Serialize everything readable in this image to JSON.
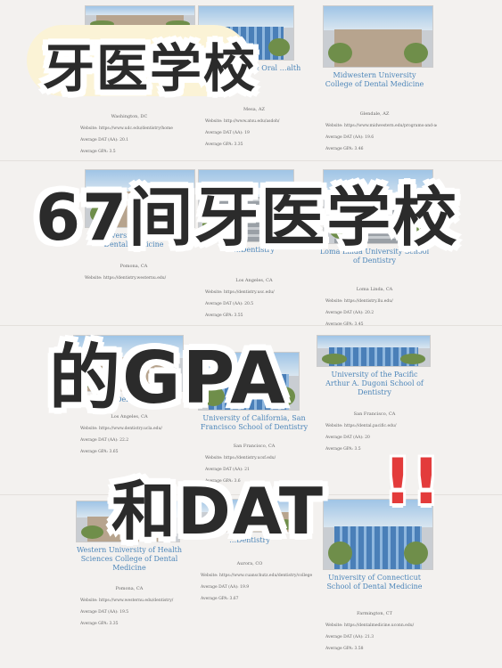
{
  "overlay": {
    "title_top": "牙医学校",
    "line2": "67间牙医学校",
    "line3": "的GPA",
    "line4": "和DAT",
    "exclaim": "!!"
  },
  "cards": [
    {
      "name": "Dentistry",
      "loc": "Washington, DC",
      "site": "Website: https://www.udc.edu/dentistry/home",
      "dat": "Average DAT (AA): 20.1",
      "gpa": "Average GPA: 3.5"
    },
    {
      "name": "…ool of …al & Oral …alth",
      "loc": "Mesa, AZ",
      "site": "Website: http://www.atsu.edu/asdoh/",
      "dat": "Average DAT (AA): 19",
      "gpa": "Average GPA: 3.35"
    },
    {
      "name": "Midwestern University College of Dental Medicine",
      "loc": "Glendale, AZ",
      "site": "Website: https://www.midwestern.edu/programs-and-admission/",
      "dat": "Average DAT (AA): 19.6",
      "gpa": "Average GPA: 3.46"
    },
    {
      "name": "…University, College of Dental Medicine",
      "loc": "Pomona, CA",
      "site": "Website: https://dentistry.westernu.edu/",
      "dat": "",
      "gpa": ""
    },
    {
      "name": "…Dentistry",
      "loc": "Los Angeles, CA",
      "site": "Website: https://dentistry.usc.edu/",
      "dat": "Average DAT (AA): 20.5",
      "gpa": "Average GPA: 3.55"
    },
    {
      "name": "Loma Linda University School of Dentistry",
      "loc": "Loma Linda, CA",
      "site": "Website: https://dentistry.llu.edu/",
      "dat": "Average DAT (AA): 20.2",
      "gpa": "Average GPA: 3.45"
    },
    {
      "name": "…Dentistry",
      "loc": "Los Angeles, CA",
      "site": "Website: https://www.dentistry.ucla.edu/",
      "dat": "Average DAT (AA): 22.2",
      "gpa": "Average GPA: 3.65"
    },
    {
      "name": "University of California, San Francisco School of Dentistry",
      "loc": "San Francisco, CA",
      "site": "Website: https://dentistry.ucsf.edu/",
      "dat": "Average DAT (AA): 21",
      "gpa": "Average GPA: 3.6"
    },
    {
      "name": "University of the Pacific Arthur A. Dugoni School of Dentistry",
      "loc": "San Francisco, CA",
      "site": "Website: https://dental.pacific.edu/",
      "dat": "Average DAT (AA): 20",
      "gpa": "Average GPA: 3.5"
    },
    {
      "name": "Western University of Health Sciences College of Dental Medicine",
      "loc": "Pomona, CA",
      "site": "Website: https://www.westernu.edu/dentistry/",
      "dat": "Average DAT (AA): 19.5",
      "gpa": "Average GPA: 3.35"
    },
    {
      "name": "…Dentistry",
      "loc": "Aurora, CO",
      "site": "Website: https://www.cuanschutz.edu/dentistry/collegeofdentalmedicine",
      "dat": "Average DAT (AA): 19.9",
      "gpa": "Average GPA: 3.67"
    },
    {
      "name": "University of Connecticut School of Dental Medicine",
      "loc": "Farmington, CT",
      "site": "Website: https://dentalmedicine.uconn.edu/",
      "dat": "Average DAT (AA): 21.3",
      "gpa": "Average GPA: 3.58"
    }
  ]
}
